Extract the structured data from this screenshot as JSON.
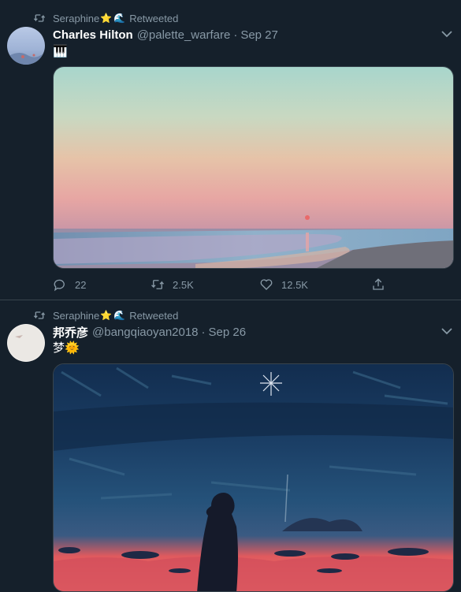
{
  "tweets": [
    {
      "retweeted_by": "Seraphine",
      "retweeted_emojis": [
        "⭐",
        "🌊"
      ],
      "retweeted_label": "Retweeted",
      "author_name": "Charles Hilton",
      "handle": "@palette_warfare",
      "separator": "·",
      "date": "Sep 27",
      "text": "🎹",
      "media_icon": "landscape-sunset-beach-image",
      "replies": "22",
      "retweets": "2.5K",
      "likes": "12.5K"
    },
    {
      "retweeted_by": "Seraphine",
      "retweeted_emojis": [
        "⭐",
        "🌊"
      ],
      "retweeted_label": "Retweeted",
      "author_name": "邦乔彦",
      "handle": "@bangqiaoyan2018",
      "separator": "·",
      "date": "Sep 26",
      "text": "梦🌞",
      "media_icon": "girl-silhouette-night-sky-image"
    }
  ],
  "colors": {
    "background": "#15202b",
    "muted": "#8899a6",
    "divider": "#38444d"
  }
}
